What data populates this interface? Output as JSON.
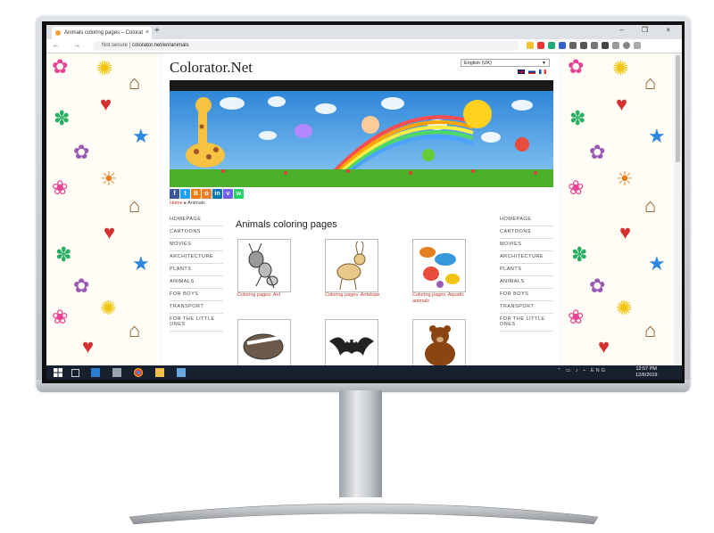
{
  "browser": {
    "tab_title": "Animals coloring pages – Colorat",
    "tab_close": "×",
    "new_tab": "+",
    "window_controls": "– ❐ ×",
    "nav": "← → C",
    "security": "Not secure",
    "separator": "|",
    "url": "colorator.net/en/animals"
  },
  "site": {
    "logo": "Colorator.Net",
    "language": "English (UK)",
    "breadcrumb_home": "Home",
    "breadcrumb_current": "Animals",
    "heading": "Animals coloring pages"
  },
  "social": [
    {
      "icon": "facebook-icon",
      "glyph": "f",
      "color": "#3b5998"
    },
    {
      "icon": "twitter-icon",
      "glyph": "t",
      "color": "#1da1f2"
    },
    {
      "icon": "blogger-icon",
      "glyph": "B",
      "color": "#f57d00"
    },
    {
      "icon": "odnoklassniki-icon",
      "glyph": "o",
      "color": "#ed812b"
    },
    {
      "icon": "linkedin-icon",
      "glyph": "in",
      "color": "#0077b5"
    },
    {
      "icon": "viber-icon",
      "glyph": "v",
      "color": "#7360f2"
    },
    {
      "icon": "whatsapp-icon",
      "glyph": "w",
      "color": "#25d366"
    }
  ],
  "nav_left": [
    "HOMEPAGE",
    "CARTOONS",
    "MOVIES",
    "ARCHITECTURE",
    "PLANTS",
    "ANIMALS",
    "FOR BOYS",
    "TRANSPORT",
    "FOR THE LITTLE ONES"
  ],
  "nav_right": [
    "HOMEPAGE",
    "CARTOONS",
    "MOVIES",
    "ARCHITECTURE",
    "PLANTS",
    "ANIMALS",
    "FOR BOYS",
    "TRANSPORT",
    "FOR THE LITTLE ONES"
  ],
  "gallery": [
    {
      "caption": "Coloring pages: Ant",
      "icon": "ant-icon"
    },
    {
      "caption": "Coloring pages: Antelope",
      "icon": "antelope-icon"
    },
    {
      "caption": "Coloring pages: Aquatic animals",
      "icon": "aquatic-animals-icon"
    },
    {
      "caption": "",
      "icon": "badger-icon"
    },
    {
      "caption": "",
      "icon": "bat-icon"
    },
    {
      "caption": "",
      "icon": "bear-icon"
    }
  ],
  "taskbar": {
    "clock_time": "12:57 PM",
    "clock_date": "12/6/2019",
    "lang": "ENG"
  },
  "colors": {
    "accent_red": "#c0392b",
    "taskbar": "#16202f",
    "sky": "#4fa3e8",
    "grass": "#4caf2a"
  }
}
